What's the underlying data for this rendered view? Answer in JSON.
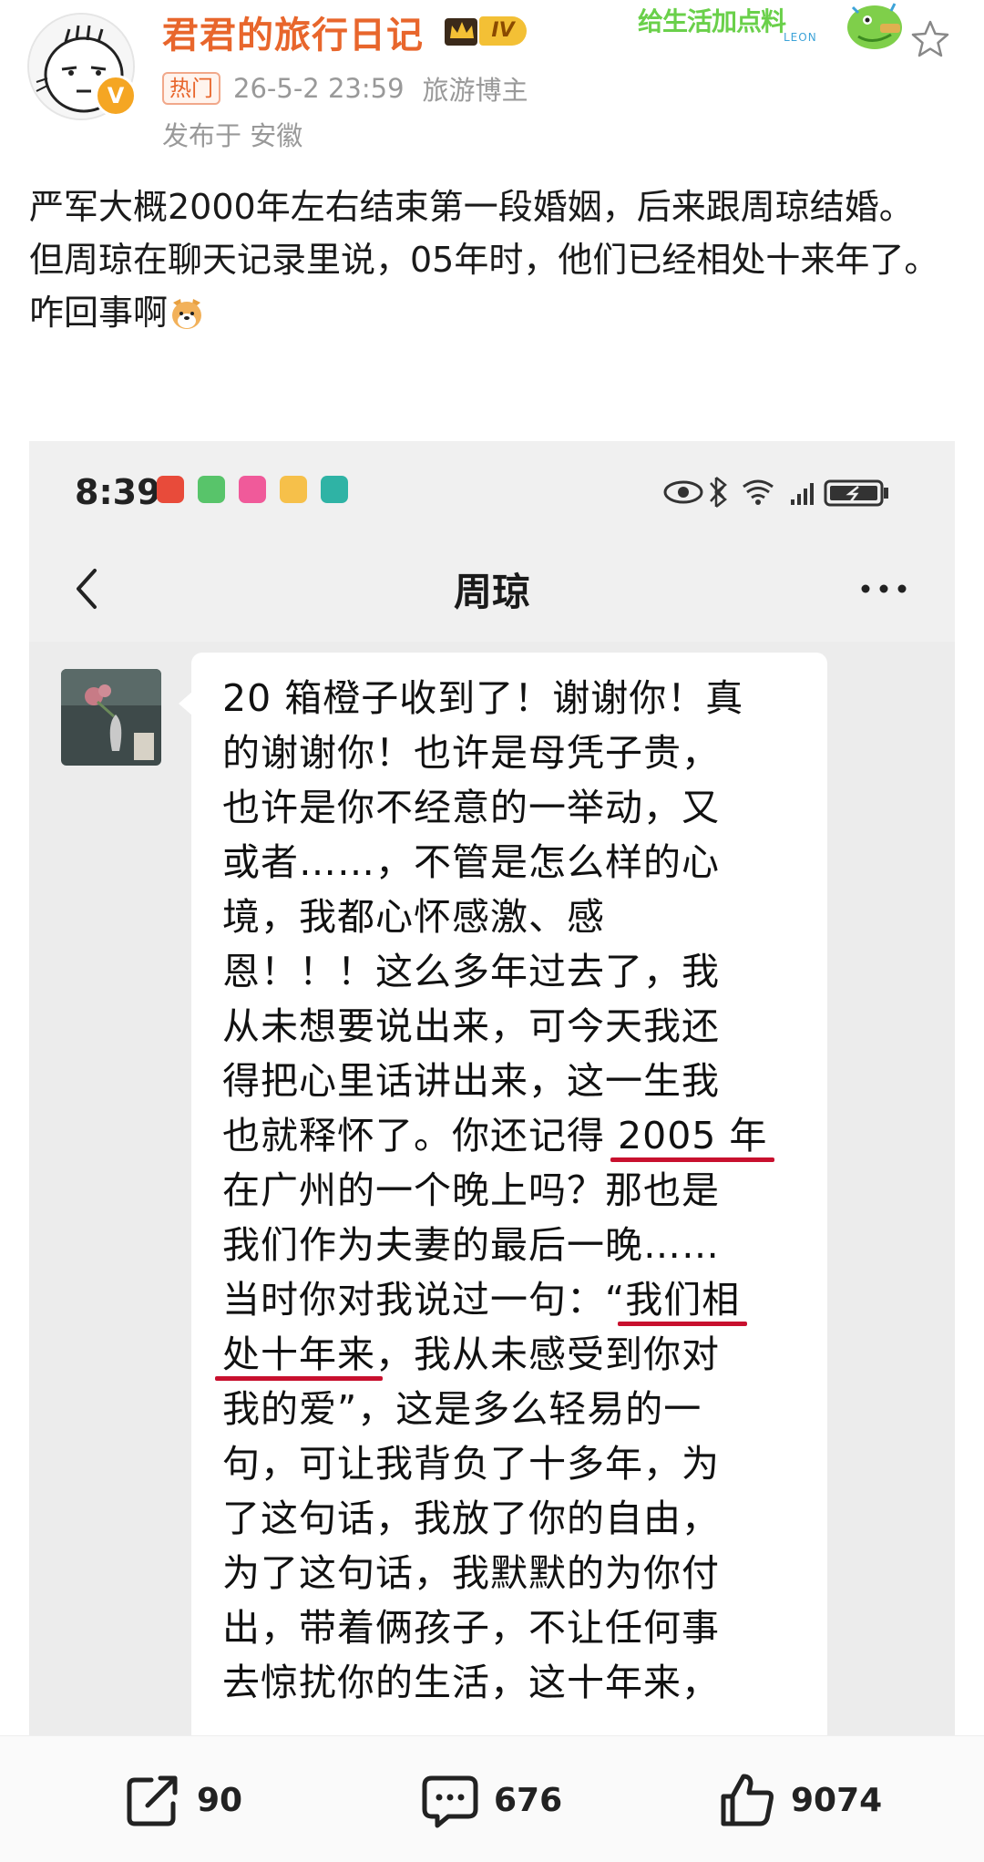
{
  "post": {
    "username": "君君的旅行日记",
    "level": "IV",
    "hot_tag": "热门",
    "time": "26-5-2 23:59",
    "role": "旅游博主",
    "location": "发布于 安徽",
    "sticker": {
      "text": "给生活加点料",
      "sub": "LEON"
    },
    "body": [
      "严军大概2000年左右结束第一段婚姻，后来跟周琼结婚。",
      "但周琼在聊天记录里说，05年时，他们已经相处十来年了。",
      "咋回事啊"
    ]
  },
  "screenshot": {
    "clock": "8:39",
    "chat_title": "周琼",
    "message_lines": [
      "20 箱橙子收到了！谢谢你！真",
      "的谢谢你！也许是母凭子贵，",
      "也许是你不经意的一举动，又",
      "或者……，不管是怎么样的心",
      "境，我都心怀感激、感",
      "恩！！！这么多年过去了，我",
      "从未想要说出来，可今天我还",
      "得把心里话讲出来，这一生我",
      "也就释怀了。你还记得 2005 年",
      "在广州的一个晚上吗？那也是",
      "我们作为夫妻的最后一晚……",
      "当时你对我说过一句：“我们相",
      "处十年来，我从未感受到你对",
      "我的爱”，这是多么轻易的一",
      "句，可让我背负了十多年，为",
      "了这句话，我放了你的自由，",
      "为了这句话，我默默的为你付",
      "出，带着俩孩子，不让任何事",
      "去惊扰你的生活，这十年来，"
    ],
    "highlights": [
      "2005 年",
      "我们相",
      "处十年来"
    ],
    "highlight_color": "#c8102e"
  },
  "actions": {
    "repost_count": "90",
    "comment_count": "676",
    "like_count": "9074"
  },
  "colors": {
    "username": "#e8662c",
    "meta": "#999999",
    "bubble_bg": "#ffffff",
    "chat_bg": "#ececec"
  }
}
